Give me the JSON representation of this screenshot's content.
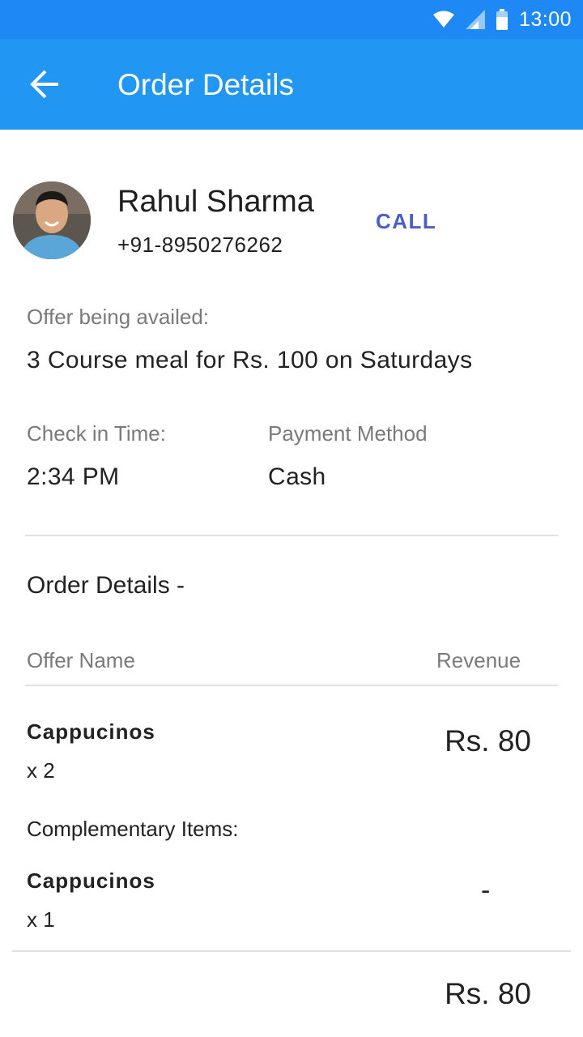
{
  "status_bar": {
    "time": "13:00",
    "icons": [
      "wifi-icon",
      "signal-icon",
      "battery-icon"
    ]
  },
  "app_bar": {
    "title": "Order Details",
    "back_icon": "arrow-back-icon"
  },
  "customer": {
    "name": "Rahul Sharma",
    "phone": "+91-8950276262",
    "call_label": "CALL"
  },
  "offer": {
    "label": "Offer being availed:",
    "value": "3 Course meal for Rs. 100 on Saturdays"
  },
  "checkin": {
    "label": "Check in Time:",
    "value": "2:34 PM"
  },
  "payment": {
    "label": "Payment Method",
    "value": "Cash"
  },
  "order": {
    "section_title": "Order Details -",
    "col_offer": "Offer Name",
    "col_revenue": "Revenue",
    "items": [
      {
        "name": "Cappucinos",
        "qty": "x 2",
        "revenue": "Rs. 80"
      }
    ],
    "complementary_label": "Complementary Items:",
    "complementary": [
      {
        "name": "Cappucinos",
        "qty": "x 1",
        "revenue": "-"
      }
    ],
    "total": "Rs. 80"
  },
  "colors": {
    "status_bar": "#1e88f5",
    "app_bar": "#2196f3",
    "call_accent": "#4a5ec9"
  }
}
